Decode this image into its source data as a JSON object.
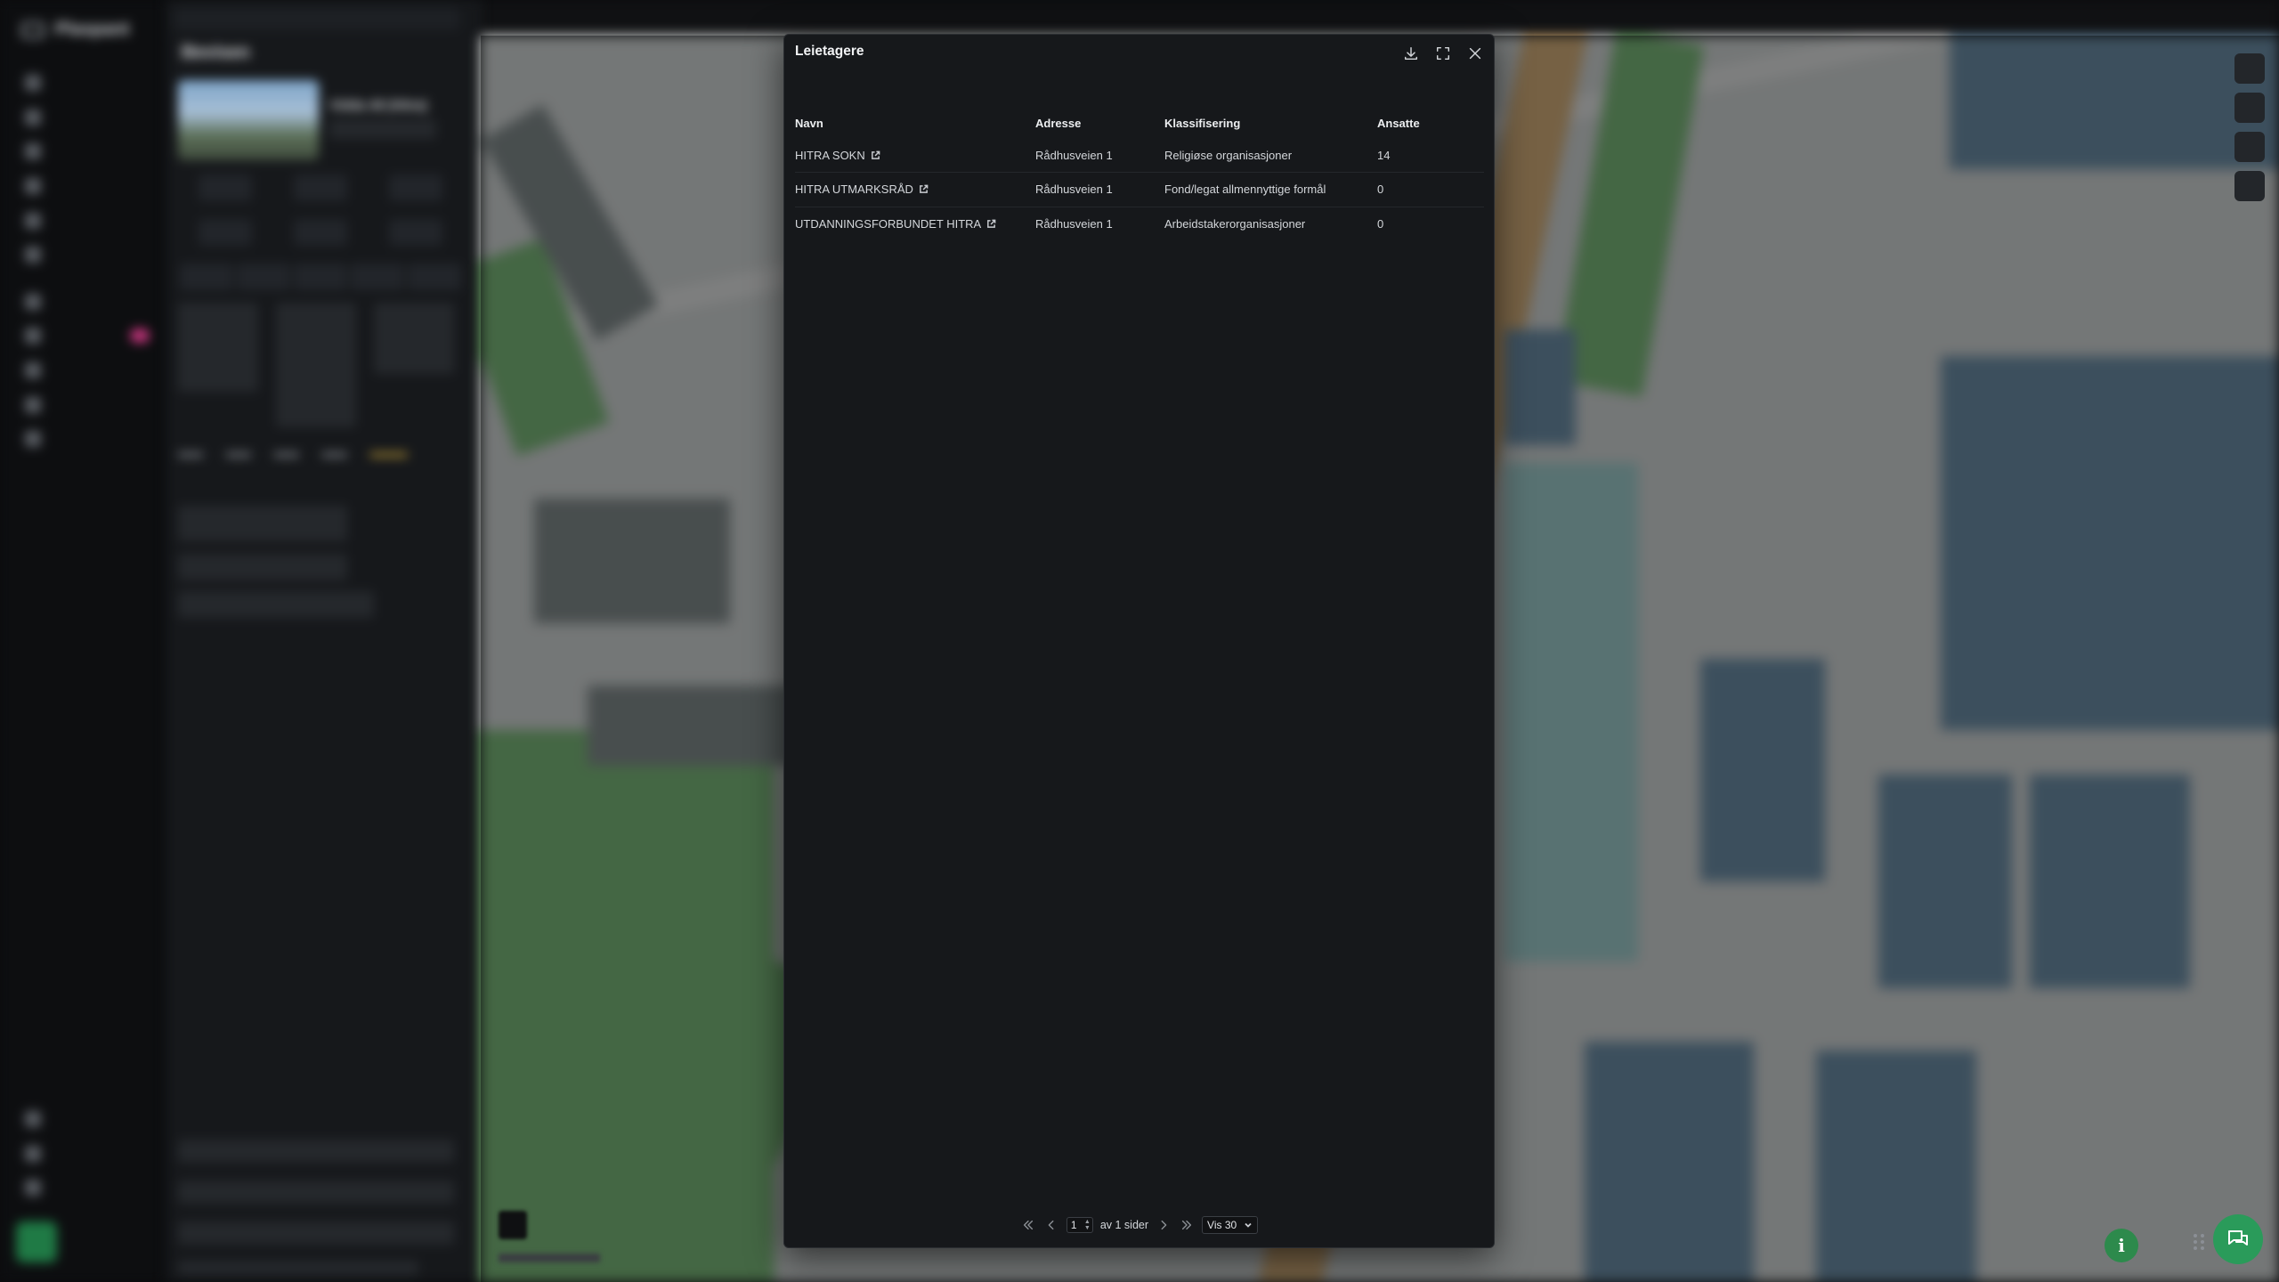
{
  "modal": {
    "title": "Leietagere",
    "columns": [
      "Navn",
      "Adresse",
      "Klassifisering",
      "Ansatte"
    ],
    "rows": [
      {
        "name": "HITRA SOKN",
        "address": "Rådhusveien 1",
        "classification": "Religiøse organisasjoner",
        "employees": "14"
      },
      {
        "name": "HITRA UTMARKSRÅD",
        "address": "Rådhusveien 1",
        "classification": "Fond/legat allmennyttige formål",
        "employees": "0"
      },
      {
        "name": "UTDANNINGSFORBUNDET HITRA",
        "address": "Rådhusveien 1",
        "classification": "Arbeidstakerorganisasjoner",
        "employees": "0"
      }
    ],
    "icons": {
      "download": "download-icon",
      "fullscreen": "fullscreen-icon",
      "close": "close-icon",
      "external_link": "external-link-icon"
    },
    "pagination": {
      "current_page": "1",
      "of_pages_label": "av 1 sider",
      "page_size_label": "Vis 30"
    }
  },
  "background": {
    "brand": "Plaspant",
    "section_title": "Bevisen",
    "property_title": "Vidda 48 (Hitra)"
  },
  "colors": {
    "modal_bg": "#16181b",
    "accent_green": "#2a9b5a",
    "map_park": "#7fc27a",
    "map_building": "#6f93ad",
    "map_main_road": "#e2b77b"
  }
}
